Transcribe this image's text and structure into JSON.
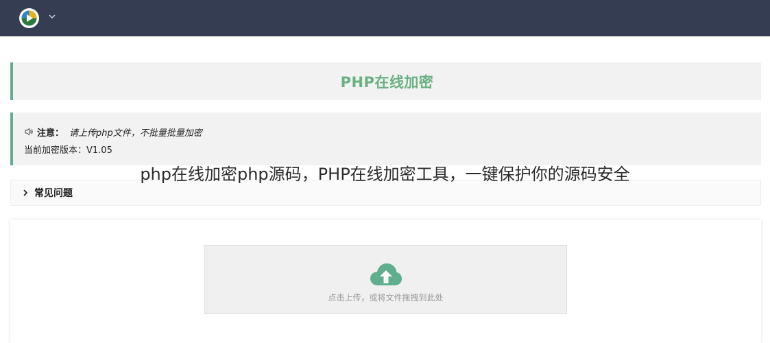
{
  "header": {
    "logo_icon": "play-logo-icon",
    "menu_icon": "chevron-down-icon"
  },
  "title_panel": {
    "title": "PHP在线加密",
    "accent_color": "#5fae8e",
    "title_color": "#6ab182"
  },
  "notice": {
    "icon": "speaker-icon",
    "label": "注意：",
    "text": "请上传php文件，不批量批量加密",
    "version_line": "当前加密版本：V1.05"
  },
  "overlay_caption": "php在线加密php源码，PHP在线加密工具，一键保护你的源码安全",
  "faq": {
    "icon": "chevron-right-icon",
    "label": "常见问题"
  },
  "upload": {
    "icon": "cloud-upload-icon",
    "hint": "点击上传，或将文件拖拽到此处",
    "icon_color": "#5fae8e"
  }
}
